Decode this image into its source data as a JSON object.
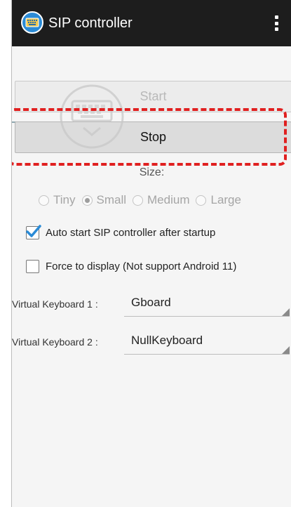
{
  "app_bar": {
    "title": "SIP controller",
    "icon": "keyboard-icon",
    "menu_icon": "overflow-menu-icon",
    "background": "#1d1d1d"
  },
  "buttons": {
    "start_label": "Start",
    "stop_label": "Stop"
  },
  "size": {
    "label": "Size:",
    "options": [
      "Tiny",
      "Small",
      "Medium",
      "Large"
    ],
    "selected": "Small"
  },
  "options": {
    "auto_start_label": "Auto start SIP controller after startup",
    "auto_start_checked": true,
    "force_display_label": "Force to display (Not support Android 11)",
    "force_display_checked": false
  },
  "keyboards": [
    {
      "label": "Virtual Keyboard 1 :",
      "value": "Gboard"
    },
    {
      "label": "Virtual Keyboard 2 :",
      "value": "NullKeyboard"
    }
  ],
  "colors": {
    "highlight": "#e02020",
    "checkbox_accent": "#2b8bd6"
  }
}
